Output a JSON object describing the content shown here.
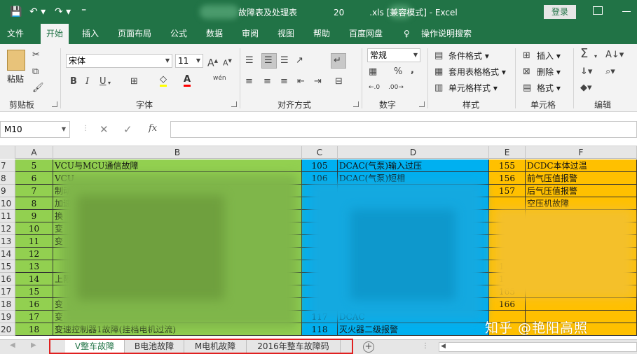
{
  "window": {
    "title_left": "",
    "title_mid": "故障表及处理表",
    "title_num": "20",
    "title_right": ".xls  [兼容模式]  -  Excel",
    "login": "登录",
    "qa_save": "💾",
    "qa_undo": "↶ ▾",
    "qa_redo": "↷ ▾",
    "qa_more": "⁼"
  },
  "tabs": [
    "文件",
    "开始",
    "插入",
    "页面布局",
    "公式",
    "数据",
    "审阅",
    "视图",
    "帮助",
    "百度网盘",
    "操作说明搜索"
  ],
  "ribbon": {
    "clipboard": {
      "label": "剪贴板",
      "paste": "粘贴"
    },
    "font": {
      "label": "字体",
      "name": "宋体",
      "size": "11",
      "bold": "B",
      "italic": "I",
      "underline": "U",
      "wen": "wén"
    },
    "alignment": {
      "label": "对齐方式"
    },
    "number": {
      "label": "数字",
      "format": "常规",
      "percent": "%",
      "comma": ","
    },
    "styles": {
      "label": "样式",
      "conditional": "条件格式",
      "table_format": "套用表格格式",
      "cell_styles": "单元格样式"
    },
    "cells": {
      "label": "单元格",
      "insert": "插入",
      "delete": "删除",
      "format": "格式"
    },
    "editing": {
      "label": "编辑",
      "sum": "Σ"
    }
  },
  "formula_bar": {
    "namebox": "M10",
    "cancel": "✕",
    "enter": "✓",
    "fx": "fx",
    "value": ""
  },
  "columns": [
    "A",
    "B",
    "C",
    "D",
    "E",
    "F"
  ],
  "colors": {
    "green": "#92d050",
    "blue": "#00b0f0",
    "orange": "#ffc000",
    "excel_green": "#217346"
  },
  "rows": [
    {
      "r": "7",
      "a": "5",
      "b": "VCU与MCU通信故障",
      "c": "105",
      "d": "DCAC(气泵)输入过压",
      "e": "155",
      "f": "DCDC本体过温"
    },
    {
      "r": "8",
      "a": "6",
      "b": "VCU",
      "c": "106",
      "d": "DCAC(气泵)短相",
      "e": "156",
      "f": "前气压值报警"
    },
    {
      "r": "9",
      "a": "7",
      "b": "制动",
      "c": "",
      "d": "",
      "e": "157",
      "f": "后气压值报警"
    },
    {
      "r": "10",
      "a": "8",
      "b": "加速",
      "c": "",
      "d": "",
      "e": "",
      "f": "空压机故障"
    },
    {
      "r": "11",
      "a": "9",
      "b": "换",
      "c": "",
      "d": "",
      "e": "",
      "f": ""
    },
    {
      "r": "12",
      "a": "10",
      "b": "变",
      "c": "",
      "d": "",
      "e": "",
      "f": ""
    },
    {
      "r": "13",
      "a": "11",
      "b": "变",
      "c": "",
      "d": "",
      "e": "",
      "f": ""
    },
    {
      "r": "14",
      "a": "12",
      "b": "",
      "c": "",
      "d": "",
      "e": "",
      "f": ""
    },
    {
      "r": "15",
      "a": "13",
      "b": "",
      "c": "",
      "d": "",
      "e": "163",
      "f": ""
    },
    {
      "r": "16",
      "a": "14",
      "b": "上限溢出)",
      "c": "",
      "d": "",
      "e": "164",
      "f": ""
    },
    {
      "r": "17",
      "a": "15",
      "b": "",
      "c": "",
      "d": "",
      "e": "165",
      "f": ""
    },
    {
      "r": "18",
      "a": "16",
      "b": "变",
      "c": "",
      "d": "",
      "e": "166",
      "f": ""
    },
    {
      "r": "19",
      "a": "17",
      "b": "变",
      "c": "117",
      "d": "DCAC",
      "e": "",
      "f": ""
    },
    {
      "r": "20",
      "a": "18",
      "b": "变速控制器1故障(挂档电机过流)",
      "c": "118",
      "d": "灭火器二级报警",
      "e": "",
      "f": ""
    }
  ],
  "sheets": [
    "V整车故障",
    "B电池故障",
    "M电机故障",
    "2016年整车故障码"
  ],
  "active_sheet": "V整车故障",
  "watermark": "知乎 @艳阳高照"
}
